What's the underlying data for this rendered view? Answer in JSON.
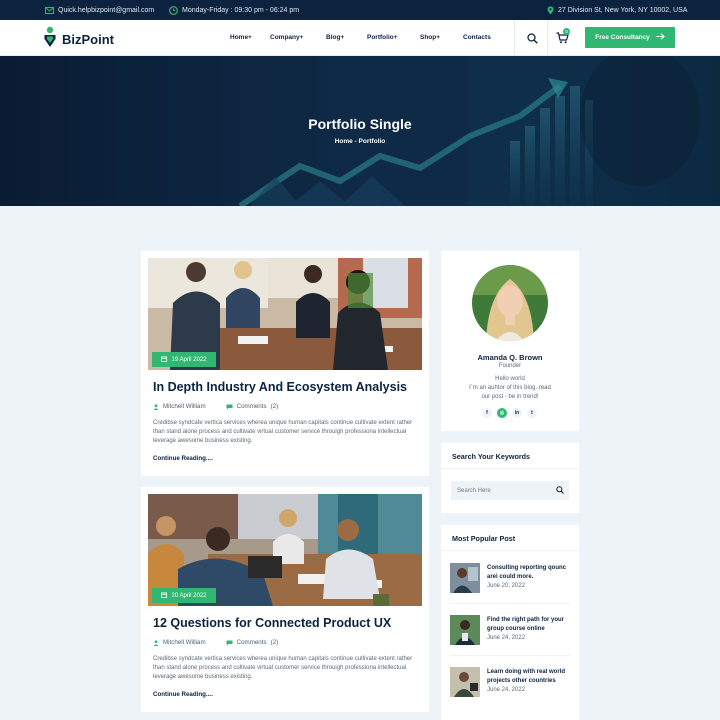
{
  "topbar": {
    "email": "Quick.helpbizpoint@gmail.com",
    "hours": "Monday-Friday : 09:30 pm - 06:24 pm",
    "address": "27 Division St, New York, NY 10002, USA"
  },
  "header": {
    "logo": "BizPoint",
    "nav": [
      "Home+",
      "Company+",
      "Blog+",
      "Portfolio+",
      "Shop+",
      "Contacts"
    ],
    "cart_count": "0",
    "cta_label": "Free Consultancy"
  },
  "hero": {
    "title": "Portfolio Single",
    "breadcrumb": "Home - Portfolio"
  },
  "posts": [
    {
      "date": "19 April 2022",
      "title": "In Depth Industry And Ecosystem Analysis",
      "author": "Mitchell William",
      "comments_label": "Comments",
      "comments_count": "(2)",
      "excerpt": "Credibse syndcate vertica services wherea unique human capitals continue cultivate extent rather than stand alone process and cultivate virtual customer service throuigh professiona intellectual leverage awesome business existing.",
      "read_more": "Continue Reading...."
    },
    {
      "date": "20 April 2022",
      "title": "12 Questions for Connected Product UX",
      "author": "Mitchell William",
      "comments_label": "Comments",
      "comments_count": "(2)",
      "excerpt": "Credibse syndcate vertica services wherea unique human capitals continue cultivate extent rather than stand alone process and cultivate virtual customer service throuigh professiona intellectual leverage awesome business existing.",
      "read_more": "Continue Reading...."
    }
  ],
  "author": {
    "name": "Amanda Q. Brown",
    "role": "Founder",
    "bio_line1": "Hello world",
    "bio_line2": "I`m an auhtor of this blog. read",
    "bio_line3": "our post - be in trend!",
    "social": [
      "f",
      "◎",
      "in",
      "t"
    ]
  },
  "search_widget": {
    "title": "Search Your Keywords",
    "placeholder": "Search Here"
  },
  "popular": {
    "title": "Most Popular Post",
    "items": [
      {
        "title": "Consulting reporting qounc arei could more.",
        "date": "June 20, 2022"
      },
      {
        "title": "Find the right path for your group course online",
        "date": "June 24, 2022"
      },
      {
        "title": "Learn doing with real world projects other countries",
        "date": "June 24, 2022"
      }
    ]
  },
  "colors": {
    "brand": "#32b773",
    "navy": "#0c2340",
    "bg": "#eef3f8"
  }
}
